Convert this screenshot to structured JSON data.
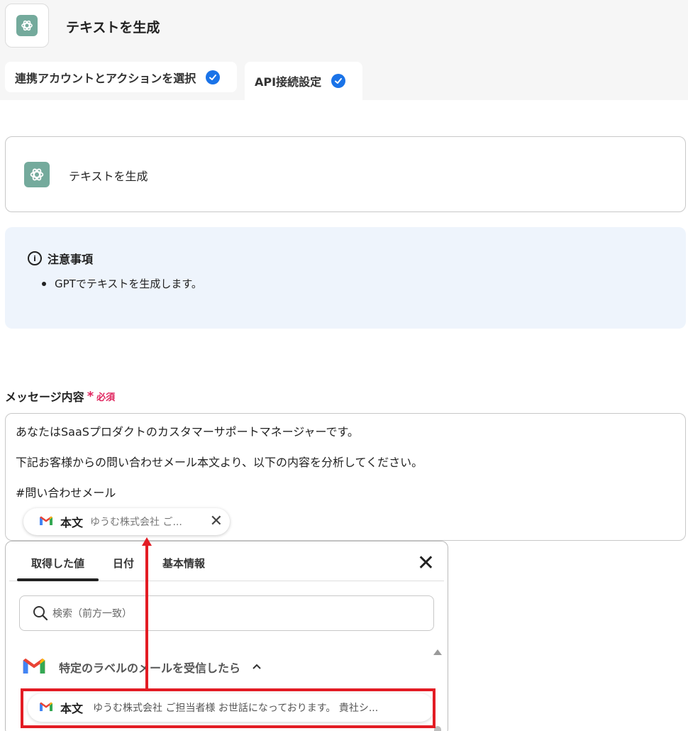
{
  "header": {
    "title": "テキストを生成",
    "tabs": [
      {
        "label": "連携アカウントとアクションを選択",
        "completed": true
      },
      {
        "label": "API接続設定",
        "completed": true
      }
    ]
  },
  "action": {
    "title": "テキストを生成",
    "icon": "chatgpt-logo-icon"
  },
  "notice": {
    "title": "注意事項",
    "items": [
      "GPTでテキストを生成します。"
    ]
  },
  "message_field": {
    "label": "メッセージ内容",
    "required_mark": "*",
    "required_text": "必須",
    "lines": [
      "あなたはSaaSプロダクトのカスタマーサポートマネージャーです。",
      "下記お客様からの問い合わせメール本文より、以下の内容を分析してください。",
      "#問い合わせメール"
    ],
    "chip": {
      "label": "本文",
      "value": "ゆうむ株式会社 ご..."
    }
  },
  "popup": {
    "tabs": [
      "取得した値",
      "日付",
      "基本情報"
    ],
    "active_tab": "取得した値",
    "search_placeholder": "検索（前方一致）",
    "section": {
      "title": "特定のラベルのメールを受信したら",
      "expanded": true
    },
    "item": {
      "label": "本文",
      "value": "ゆうむ株式会社 ご担当者様 お世話になっております。 貴社シ..."
    }
  },
  "colors": {
    "accent": "#1a73e8",
    "gpt_green": "#74aa9c",
    "required": "#e0245e",
    "annotation_red": "#e31c24",
    "notice_bg": "#eef4fc"
  }
}
